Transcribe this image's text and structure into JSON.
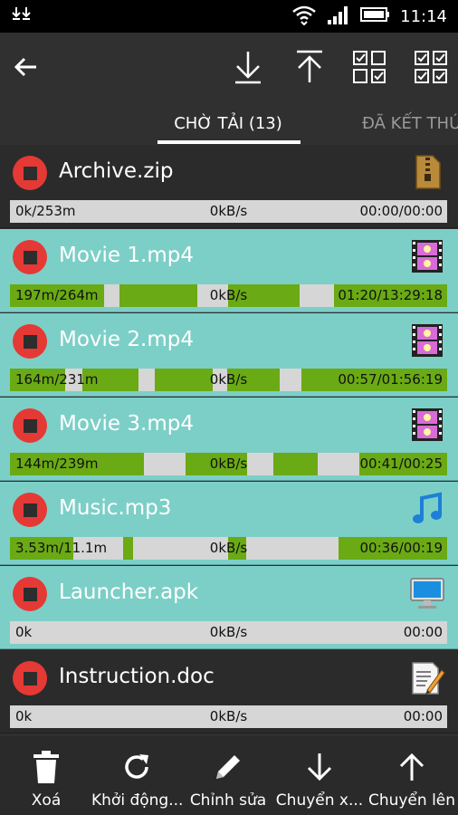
{
  "status_bar": {
    "time": "11:14"
  },
  "tabs": [
    {
      "label": "CHỜ TẢI (13)"
    },
    {
      "label": "ĐÃ KẾT THÚ"
    }
  ],
  "downloads": [
    {
      "name": "Archive.zip",
      "icon": "zip-archive-icon",
      "size": "0k/253m",
      "speed": "0kB/s",
      "time": "00:00/00:00"
    },
    {
      "name": "Movie 1.mp4",
      "icon": "film-icon",
      "size": "197m/264m",
      "speed": "0kB/s",
      "time": "01:20/13:29:18"
    },
    {
      "name": "Movie 2.mp4",
      "icon": "film-icon",
      "size": "164m/231m",
      "speed": "0kB/s",
      "time": "00:57/01:56:19"
    },
    {
      "name": "Movie 3.mp4",
      "icon": "film-icon",
      "size": "144m/239m",
      "speed": "0kB/s",
      "time": "00:41/00:25"
    },
    {
      "name": "Music.mp3",
      "icon": "music-note-icon",
      "size": "3.53m/11.1m",
      "speed": "0kB/s",
      "time": "00:36/00:19"
    },
    {
      "name": "Launcher.apk",
      "icon": "monitor-icon",
      "size": "0k",
      "speed": "0kB/s",
      "time": "00:00"
    },
    {
      "name": "Instruction.doc",
      "icon": "document-edit-icon",
      "size": "0k",
      "speed": "0kB/s",
      "time": "00:00"
    }
  ],
  "bottom_bar": [
    {
      "label": "Xoá",
      "icon": "trash-icon"
    },
    {
      "label": "Khởi động...",
      "icon": "refresh-icon"
    },
    {
      "label": "Chỉnh sửa",
      "icon": "pencil-icon"
    },
    {
      "label": "Chuyển x...",
      "icon": "arrow-down-icon"
    },
    {
      "label": "Chuyển lên",
      "icon": "arrow-up-icon"
    }
  ],
  "colors": {
    "accent": "#6aaa14",
    "stop": "#e53935",
    "row_teal": "#7ccfc7",
    "row_dark": "#2b2b2b"
  }
}
